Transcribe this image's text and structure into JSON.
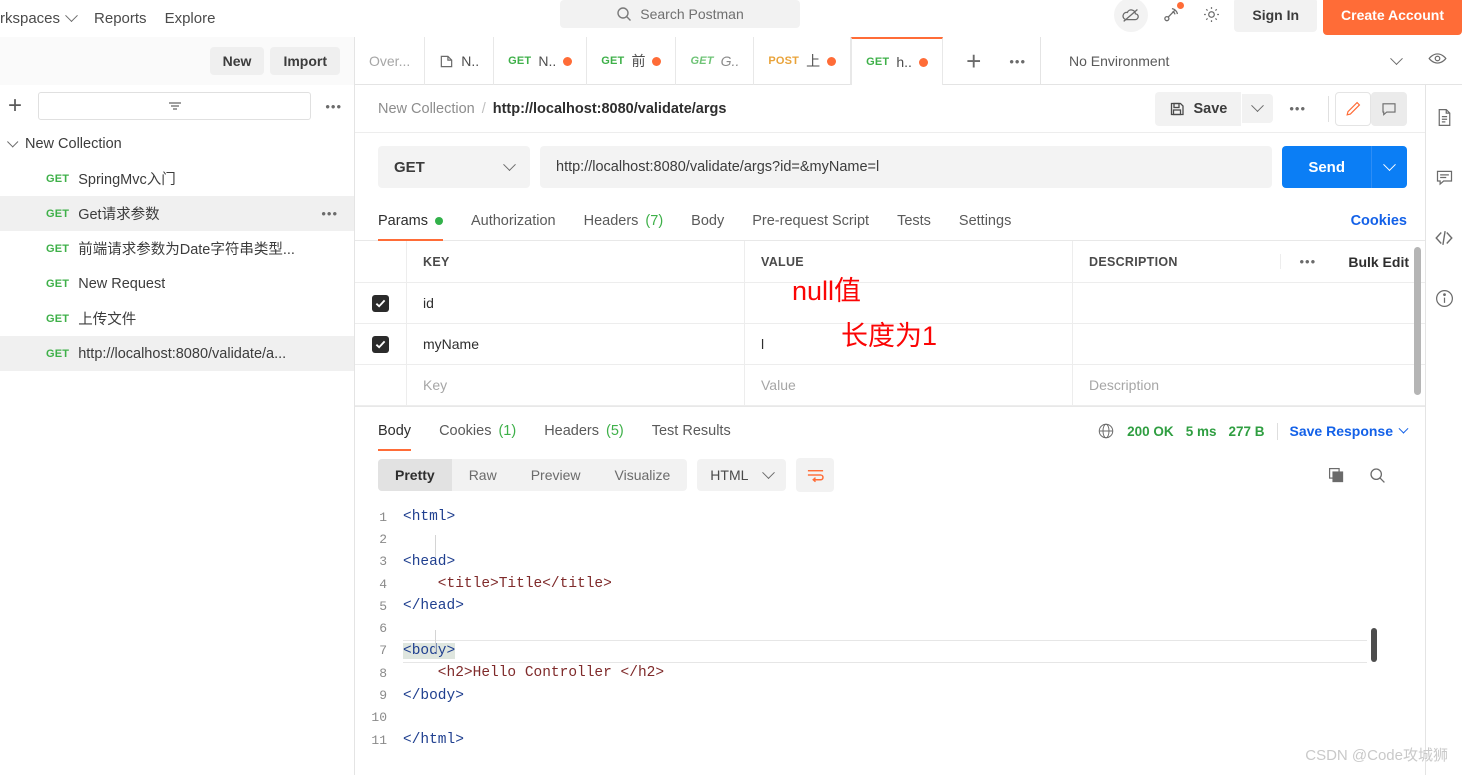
{
  "topbar": {
    "workspaces": "rkspaces",
    "reports": "Reports",
    "explore": "Explore",
    "search_placeholder": "Search Postman",
    "sign_in": "Sign In",
    "create_account": "Create Account",
    "icons": {
      "cloud": "cloud-offline-icon",
      "notifications": "satellite-notifications-icon",
      "settings": "gear-icon"
    }
  },
  "sidebar_head": {
    "new_label": "New",
    "import_label": "Import"
  },
  "tabs": [
    {
      "label": "Over...",
      "method": "",
      "kind": "overview",
      "dirty": false,
      "active": false
    },
    {
      "label": "N..",
      "method": "",
      "kind": "folder",
      "dirty": false,
      "active": false
    },
    {
      "label": "N..",
      "method": "GET",
      "kind": "request",
      "dirty": true,
      "active": false
    },
    {
      "label": "前",
      "method": "GET",
      "kind": "request",
      "dirty": true,
      "active": false
    },
    {
      "label": "G..",
      "method": "GET",
      "kind": "request",
      "dirty": false,
      "active": false,
      "italic": true
    },
    {
      "label": "上",
      "method": "POST",
      "kind": "request",
      "dirty": true,
      "active": false
    },
    {
      "label": "h..",
      "method": "GET",
      "kind": "request",
      "dirty": true,
      "active": true
    }
  ],
  "tab_actions": {
    "add": "+",
    "more": "•••"
  },
  "environment": {
    "selected": "No Environment",
    "eye": "eye-icon"
  },
  "sidebar": {
    "filter_placeholder": "",
    "collection": "New Collection",
    "items": [
      {
        "method": "GET",
        "label": "SpringMvc入门",
        "selected": false
      },
      {
        "method": "GET",
        "label": "Get请求参数",
        "selected": true,
        "hover": true
      },
      {
        "method": "GET",
        "label": "前端请求参数为Date字符串类型...",
        "selected": false
      },
      {
        "method": "GET",
        "label": "New Request",
        "selected": false
      },
      {
        "method": "GET",
        "label": "上传文件",
        "selected": false
      },
      {
        "method": "GET",
        "label": "http://localhost:8080/validate/a...",
        "selected": true
      }
    ]
  },
  "breadcrumb": {
    "collection": "New Collection",
    "separator": "/",
    "request": "http://localhost:8080/validate/args",
    "save_label": "Save",
    "more": "•••"
  },
  "request": {
    "method": "GET",
    "url": "http://localhost:8080/validate/args?id=&myName=l",
    "send_label": "Send"
  },
  "request_tabs": [
    {
      "label": "Params",
      "badge": "dot",
      "active": true
    },
    {
      "label": "Authorization",
      "badge": "",
      "active": false
    },
    {
      "label": "Headers",
      "count": "(7)",
      "active": false
    },
    {
      "label": "Body",
      "badge": "",
      "active": false
    },
    {
      "label": "Pre-request Script",
      "badge": "",
      "active": false
    },
    {
      "label": "Tests",
      "badge": "",
      "active": false
    },
    {
      "label": "Settings",
      "badge": "",
      "active": false
    }
  ],
  "cookies_link": "Cookies",
  "params_table": {
    "headers": {
      "key": "KEY",
      "value": "VALUE",
      "description": "DESCRIPTION"
    },
    "bulk_edit": "Bulk Edit",
    "more": "•••",
    "rows": [
      {
        "checked": true,
        "key": "id",
        "value": "",
        "description": ""
      },
      {
        "checked": true,
        "key": "myName",
        "value": "l",
        "description": ""
      }
    ],
    "placeholder_row": {
      "key": "Key",
      "value": "Value",
      "description": "Description"
    },
    "annotations": [
      {
        "text": "null值",
        "for": "id-value",
        "color": "#fb0505"
      },
      {
        "text": "长度为1",
        "for": "myName-value",
        "color": "#fb0505"
      }
    ]
  },
  "response": {
    "tabs": [
      {
        "label": "Body",
        "count": "",
        "active": true
      },
      {
        "label": "Cookies",
        "count": "(1)",
        "active": false
      },
      {
        "label": "Headers",
        "count": "(5)",
        "active": false
      },
      {
        "label": "Test Results",
        "count": "",
        "active": false
      }
    ],
    "status": "200 OK",
    "time": "5 ms",
    "size": "277 B",
    "save_response": "Save Response",
    "viewer_modes": [
      "Pretty",
      "Raw",
      "Preview",
      "Visualize"
    ],
    "viewer_active": "Pretty",
    "format": "HTML",
    "code_lines": [
      {
        "n": "1",
        "text": "<html>"
      },
      {
        "n": "2",
        "text": ""
      },
      {
        "n": "3",
        "text": "<head>"
      },
      {
        "n": "4",
        "text": "    <title>Title</title>"
      },
      {
        "n": "5",
        "text": "</head>"
      },
      {
        "n": "6",
        "text": ""
      },
      {
        "n": "7",
        "text": "<body>"
      },
      {
        "n": "8",
        "text": "    <h2>Hello Controller </h2>"
      },
      {
        "n": "9",
        "text": "</body>"
      },
      {
        "n": "10",
        "text": ""
      },
      {
        "n": "11",
        "text": "</html>"
      }
    ]
  },
  "rail_icons": [
    "document-icon",
    "comment-icon",
    "code-icon",
    "info-icon"
  ],
  "watermark": "CSDN @Code攻城狮",
  "colors": {
    "accent": "#ff6c37",
    "send": "#0b7ef5",
    "link": "#1361e8",
    "success": "#32b14a",
    "annotation": "#fb0505"
  }
}
